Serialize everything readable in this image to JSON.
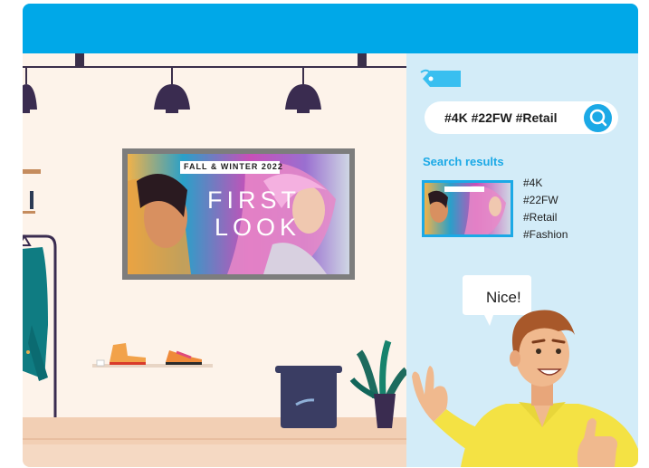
{
  "search": {
    "query": "#4K #22FW #Retail"
  },
  "results": {
    "title": "Search results",
    "tags": [
      "#4K",
      "#22FW",
      "#Retail",
      "#Fashion"
    ]
  },
  "billboard": {
    "headline": "FALL & WINTER 2022",
    "line1": "FIRST",
    "line2": "LOOK"
  },
  "speech": {
    "text": "Nice!"
  },
  "colors": {
    "accent_blue": "#00a8e8",
    "panel_bg": "#d3ecf8",
    "wall": "#fdf3ea"
  }
}
